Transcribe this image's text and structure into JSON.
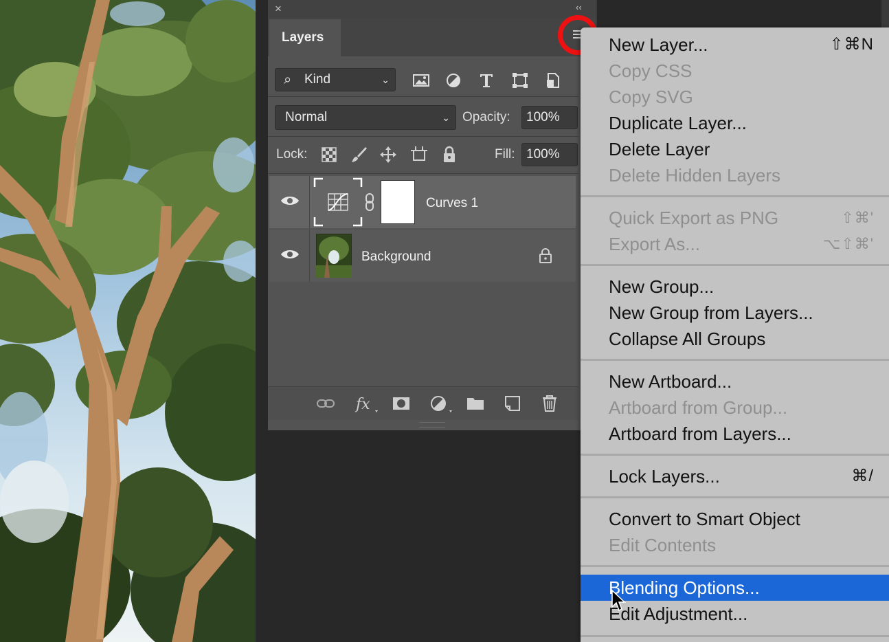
{
  "panel": {
    "close_glyph": "×",
    "collapse_glyph": "‹‹",
    "tab_label": "Layers",
    "menu_icon": "panel-menu-icon"
  },
  "filter": {
    "kind_label": "Kind",
    "icons": [
      "image-filter-icon",
      "adjustment-filter-icon",
      "type-filter-icon",
      "shape-filter-icon",
      "smart-object-filter-icon"
    ]
  },
  "blend": {
    "mode": "Normal",
    "opacity_label": "Opacity:",
    "opacity_value": "100%"
  },
  "lock": {
    "label": "Lock:",
    "fill_label": "Fill:",
    "fill_value": "100%",
    "icons": [
      "lock-transparent-icon",
      "lock-paint-icon",
      "lock-position-icon",
      "lock-artboard-icon",
      "lock-all-icon"
    ]
  },
  "layers": [
    {
      "name": "Curves 1",
      "selected": true
    },
    {
      "name": "Background",
      "selected": false
    }
  ],
  "bottom_icons": [
    "link-layers-icon",
    "fx-icon",
    "add-mask-icon",
    "new-adjustment-icon",
    "new-group-icon",
    "new-layer-icon",
    "trash-icon"
  ],
  "menu": {
    "items": [
      {
        "label": "New Layer...",
        "shortcut": "⇧⌘N",
        "disabled": false
      },
      {
        "label": "Copy CSS",
        "shortcut": "",
        "disabled": true
      },
      {
        "label": "Copy SVG",
        "shortcut": "",
        "disabled": true
      },
      {
        "label": "Duplicate Layer...",
        "shortcut": "",
        "disabled": false
      },
      {
        "label": "Delete Layer",
        "shortcut": "",
        "disabled": false
      },
      {
        "label": "Delete Hidden Layers",
        "shortcut": "",
        "disabled": true
      },
      {
        "label": "Quick Export as PNG",
        "shortcut": "⇧⌘'",
        "disabled": true
      },
      {
        "label": "Export As...",
        "shortcut": "⌥⇧⌘'",
        "disabled": true
      },
      {
        "label": "New Group...",
        "shortcut": "",
        "disabled": false
      },
      {
        "label": "New Group from Layers...",
        "shortcut": "",
        "disabled": false
      },
      {
        "label": "Collapse All Groups",
        "shortcut": "",
        "disabled": false
      },
      {
        "label": "New Artboard...",
        "shortcut": "",
        "disabled": false
      },
      {
        "label": "Artboard from Group...",
        "shortcut": "",
        "disabled": true
      },
      {
        "label": "Artboard from Layers...",
        "shortcut": "",
        "disabled": false
      },
      {
        "label": "Lock Layers...",
        "shortcut": "⌘/",
        "disabled": false
      },
      {
        "label": "Convert to Smart Object",
        "shortcut": "",
        "disabled": false
      },
      {
        "label": "Edit Contents",
        "shortcut": "",
        "disabled": true
      },
      {
        "label": "Blending Options...",
        "shortcut": "",
        "disabled": false,
        "highlighted": true
      },
      {
        "label": "Edit Adjustment...",
        "shortcut": "",
        "disabled": false
      }
    ]
  },
  "colors": {
    "highlight": "#1b67d8",
    "annotation_circle": "#ee1111",
    "panel_bg": "#535353",
    "menu_bg": "#c3c3c3"
  }
}
